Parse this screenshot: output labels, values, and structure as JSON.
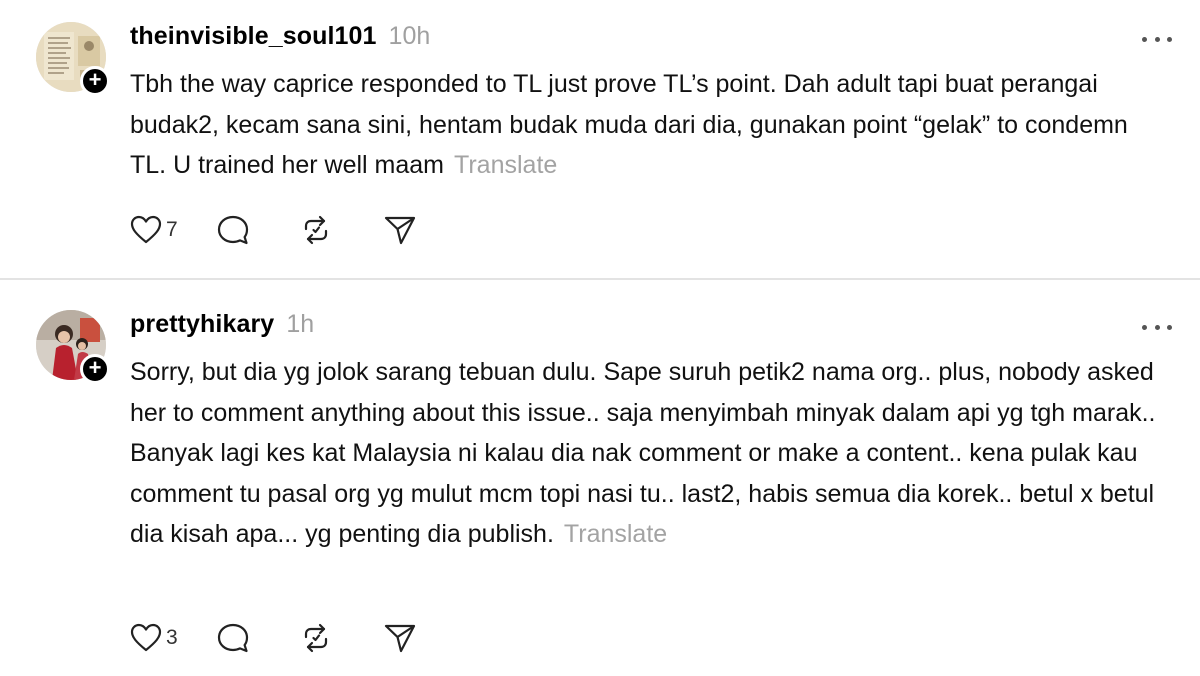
{
  "posts": [
    {
      "username": "theinvisible_soul101",
      "time": "10h",
      "text": "Tbh the way caprice responded to TL just prove TL’s point. Dah adult tapi buat perangai budak2, kecam sana sini, hentam budak muda dari dia, gunakan point “gelak” to condemn TL. U trained her well maam",
      "translate_label": "Translate",
      "like_count": "7",
      "follow_badge": "+"
    },
    {
      "username": "prettyhikary",
      "time": "1h",
      "text": "Sorry, but dia yg jolok sarang tebuan dulu. Sape suruh petik2 nama org.. plus, nobody asked her to comment anything about this issue.. saja menyimbah minyak dalam api yg tgh marak.. Banyak lagi kes kat Malaysia ni kalau dia nak comment or make a content.. kena pulak kau comment tu pasal org yg mulut mcm topi nasi tu.. last2, habis semua dia korek.. betul x betul dia kisah apa... yg penting dia publish.",
      "translate_label": "Translate",
      "like_count": "3",
      "follow_badge": "+"
    }
  ],
  "icons": [
    "heart-icon",
    "comment-icon",
    "repost-icon",
    "share-icon",
    "more-icon",
    "follow-plus-icon"
  ]
}
